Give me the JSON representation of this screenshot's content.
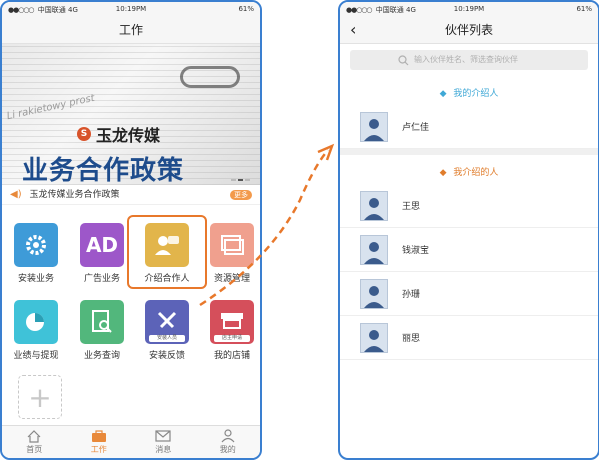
{
  "status_bar": {
    "carrier": "中国联通",
    "network": "4G",
    "time": "10:19PM",
    "battery": "61%"
  },
  "left_screen": {
    "title": "工作",
    "banner": {
      "brand": "玉龙传媒",
      "headline": "业务合作政策",
      "background_text": "Li rakietowy prost"
    },
    "notice": {
      "text": "玉龙传媒业务合作政策",
      "more": "更多"
    },
    "apps": [
      {
        "label": "安装业务",
        "icon": "gear-wrench-icon",
        "color": "#3e9bd8"
      },
      {
        "label": "广告业务",
        "icon": "ad-icon",
        "color": "#9d57c9"
      },
      {
        "label": "介绍合作人",
        "icon": "chat-person-icon",
        "color": "#e2b54b"
      },
      {
        "label": "资源管理",
        "icon": "layers-icon",
        "color": "#f0a08e"
      },
      {
        "label": "业绩与提现",
        "icon": "pie-chart-icon",
        "color": "#3fc2d8"
      },
      {
        "label": "业务查询",
        "icon": "search-document-icon",
        "color": "#52b77c"
      },
      {
        "label": "安装反馈",
        "icon": "tools-icon",
        "color": "#5c63b8",
        "tag": "安装人员"
      },
      {
        "label": "我的店铺",
        "icon": "storefront-icon",
        "color": "#d54f5b",
        "tag": "店主申请"
      },
      {
        "label": "添加",
        "icon": "plus-icon"
      }
    ],
    "tabs": [
      {
        "label": "首页",
        "icon": "home-icon"
      },
      {
        "label": "工作",
        "icon": "briefcase-icon",
        "active": true
      },
      {
        "label": "消息",
        "icon": "mail-icon"
      },
      {
        "label": "我的",
        "icon": "user-icon"
      }
    ]
  },
  "right_screen": {
    "title": "伙伴列表",
    "search_placeholder": "输入伙伴姓名、筛选查询伙伴",
    "my_introducer": {
      "header": "我的介绍人",
      "people": [
        "卢仁佳"
      ]
    },
    "my_introduced": {
      "header": "我介绍的人",
      "people": [
        "王思",
        "钱淑宝",
        "孙珊",
        "丽思"
      ]
    }
  },
  "colors": {
    "accent": "#e8893a",
    "frame": "#3a7fd0",
    "highlight": "#e8782b"
  }
}
